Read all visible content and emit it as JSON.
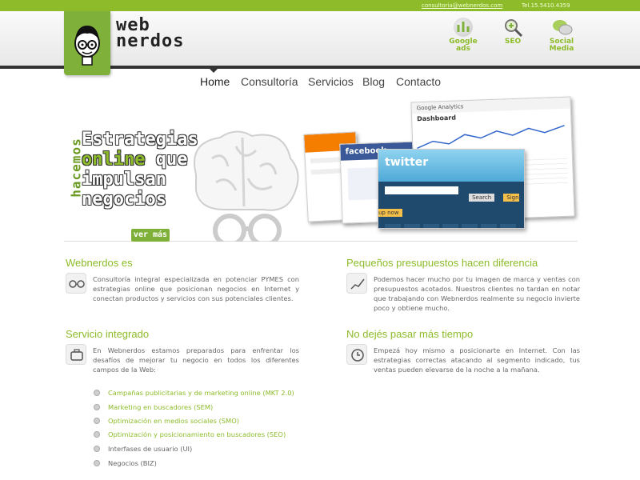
{
  "topbar": {
    "email": "consultoria@webnerdos.com",
    "phone": "Tel.15.5410.4359"
  },
  "logo": {
    "line1": "web",
    "line2": "nerdos",
    "icon": "nerd-face-icon"
  },
  "services": [
    {
      "label1": "Google",
      "label2": "ads",
      "icon": "google-ads-icon"
    },
    {
      "label1": "SEO",
      "label2": "",
      "icon": "seo-magnifier-icon"
    },
    {
      "label1": "Social",
      "label2": "Media",
      "icon": "social-media-icon"
    }
  ],
  "nav": [
    "Home",
    "Consultoría",
    "Servicios",
    "Blog",
    "Contacto"
  ],
  "hero": {
    "side": "hacemos",
    "line1": "Estrategias",
    "line2a": "online",
    "line2b": " que",
    "line3": "impulsan",
    "line4": "negocios",
    "button": "ver más",
    "shots": {
      "analytics": "Google Analytics",
      "facebook": "facebook",
      "twitter": "twitter",
      "dashboard": "Dashboard",
      "signup": "Sign up now",
      "search": "Search"
    }
  },
  "sections": [
    {
      "title": "Webnerdos es",
      "icon": "glasses-icon",
      "text": "Consultoría integral especializada en potenciar PYMES con estrategias online que posicionan negocios en Internet y conectan productos y servicios con sus potenciales clientes."
    },
    {
      "title": "Pequeños presupuestos hacen diferencia",
      "icon": "chart-icon",
      "text": "Podemos hacer mucho por tu imagen de marca y ventas con presupuestos acotados. Nuestros clientes no tardan en notar que trabajando con Webnerdos realmente su negocio invierte poco y obtiene mucho."
    },
    {
      "title": "Servicio integrado",
      "icon": "briefcase-icon",
      "text": "En Webnerdos estamos preparados para enfrentar los desafíos de mejorar tu negocio en todos los diferentes campos de la Web:"
    },
    {
      "title": "No dejés pasar más tiempo",
      "icon": "clock-icon",
      "text": "Empezá hoy mismo a posicionarte en Internet. Con las estrategias correctas atacando al segmento indicado, tus ventas pueden elevarse de la noche a la mañana."
    }
  ],
  "bullets": [
    {
      "text": "Campañas publicitarias y de marketing online (MKT 2.0)",
      "style": "green"
    },
    {
      "text": "Marketing en buscadores (SEM)",
      "style": "green"
    },
    {
      "text": "Optimización en medios sociales (SMO)",
      "style": "green"
    },
    {
      "text": "Optimización y posicionamiento en buscadores (SEO)",
      "style": "green"
    },
    {
      "text": "Interfases de usuario (UI)",
      "style": "gray"
    },
    {
      "text": "Negocios (BIZ)",
      "style": "gray"
    }
  ],
  "colors": {
    "brand": "#8dbb2a",
    "dark": "#333333"
  }
}
